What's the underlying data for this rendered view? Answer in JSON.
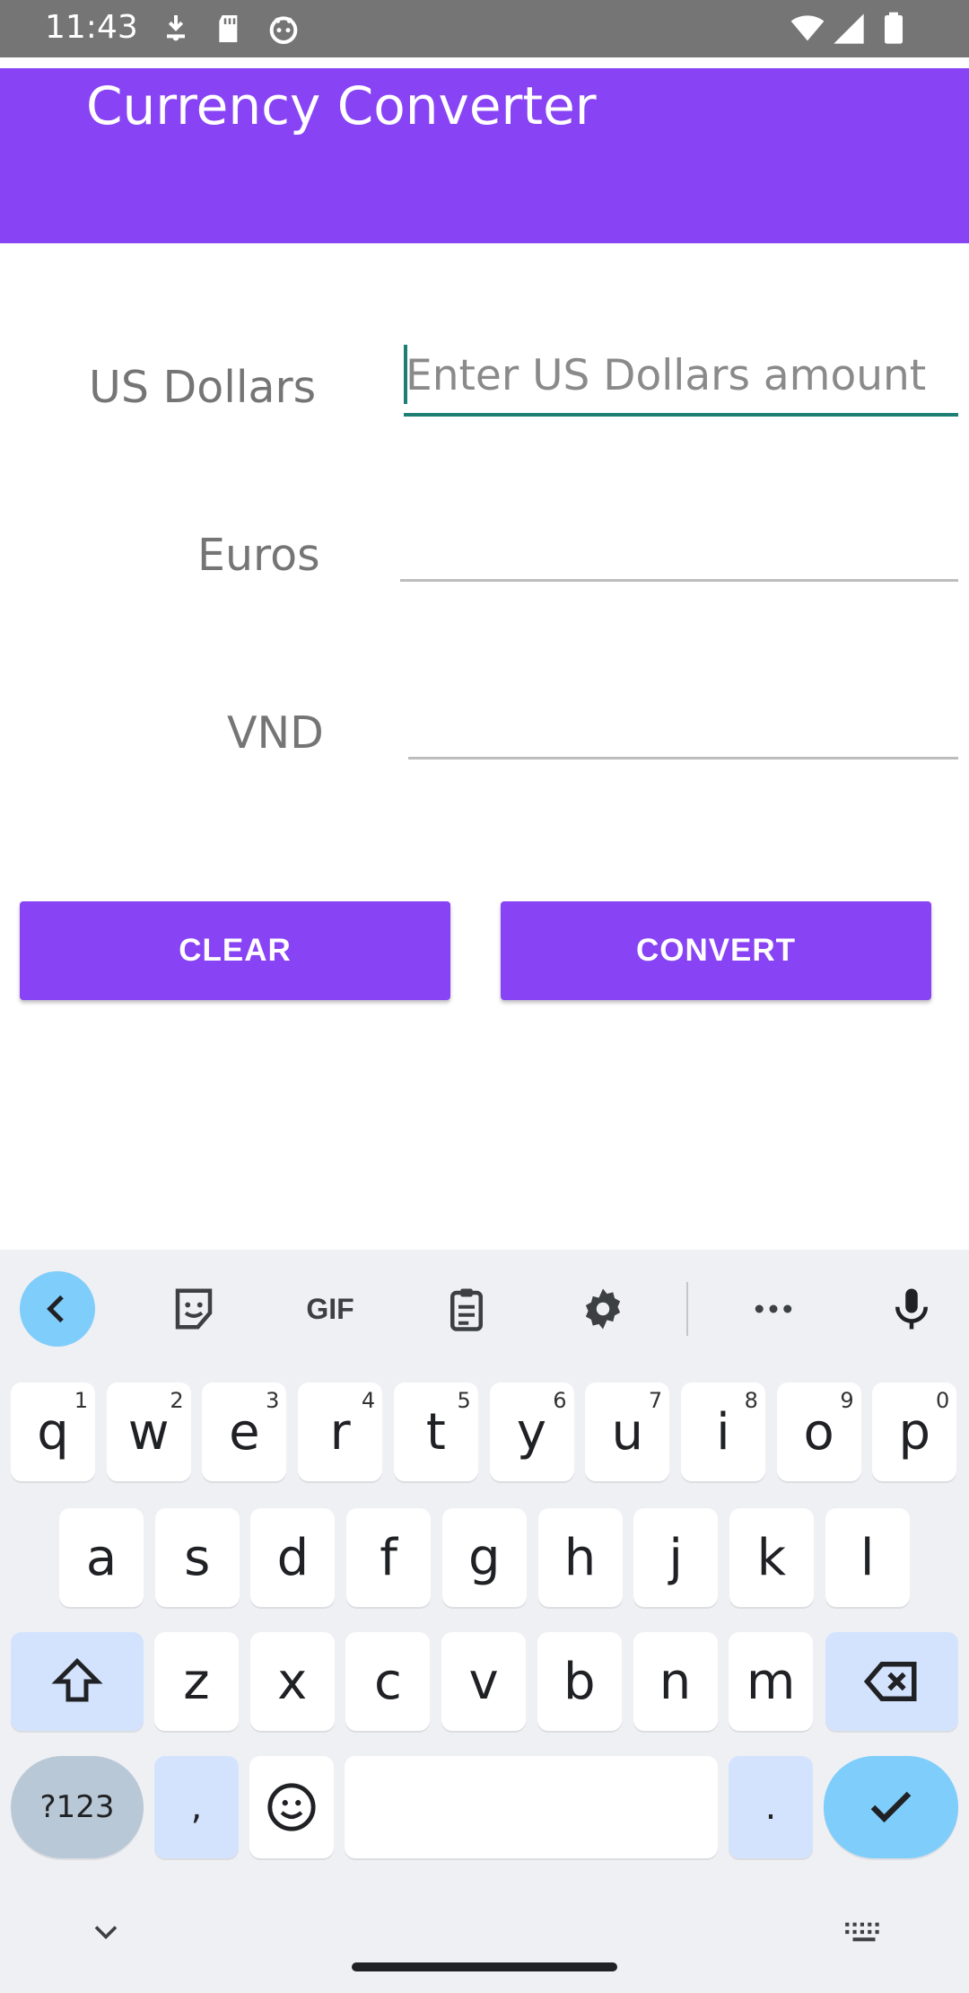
{
  "status_bar": {
    "time": "11:43"
  },
  "app": {
    "title": "Currency Converter"
  },
  "form": {
    "usd": {
      "label": "US Dollars",
      "placeholder": "Enter US Dollars amount",
      "value": ""
    },
    "eur": {
      "label": "Euros",
      "value": ""
    },
    "vnd": {
      "label": "VND",
      "value": ""
    }
  },
  "buttons": {
    "clear": "CLEAR",
    "convert": "CONVERT"
  },
  "keyboard": {
    "toolbar": {
      "gif": "GIF"
    },
    "row1": [
      {
        "k": "q",
        "h": "1"
      },
      {
        "k": "w",
        "h": "2"
      },
      {
        "k": "e",
        "h": "3"
      },
      {
        "k": "r",
        "h": "4"
      },
      {
        "k": "t",
        "h": "5"
      },
      {
        "k": "y",
        "h": "6"
      },
      {
        "k": "u",
        "h": "7"
      },
      {
        "k": "i",
        "h": "8"
      },
      {
        "k": "o",
        "h": "9"
      },
      {
        "k": "p",
        "h": "0"
      }
    ],
    "row2": [
      "a",
      "s",
      "d",
      "f",
      "g",
      "h",
      "j",
      "k",
      "l"
    ],
    "row3": [
      "z",
      "x",
      "c",
      "v",
      "b",
      "n",
      "m"
    ],
    "symbols": "?123",
    "comma": ",",
    "period": "."
  },
  "colors": {
    "primary": "#8844f4",
    "accent": "#1d7f74"
  }
}
